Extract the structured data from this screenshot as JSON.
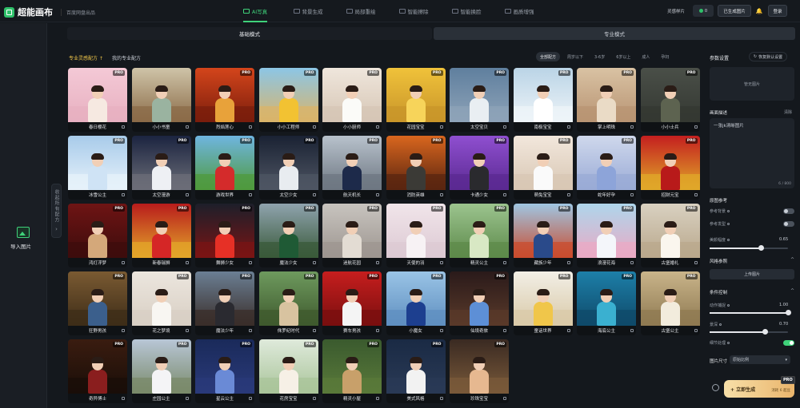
{
  "app": {
    "name": "超能画布",
    "sub": "百度网盘出品"
  },
  "nav": [
    {
      "label": "AI写真",
      "active": true
    },
    {
      "label": "背景生成",
      "active": false
    },
    {
      "label": "局部重绘",
      "active": false
    },
    {
      "label": "智能擦除",
      "active": false
    },
    {
      "label": "智能换脸",
      "active": false
    },
    {
      "label": "画质增强",
      "active": false
    }
  ],
  "topright": {
    "help": "灵感样片",
    "credits": "0",
    "generated": "已生成图片",
    "login": "登录"
  },
  "left": {
    "import_label": "导入图片",
    "collapse_label": "收起所有配方",
    "collapse_icon": "›"
  },
  "mode": {
    "basic": "基础模式",
    "pro": "专业模式"
  },
  "subtabs": [
    {
      "label": "专业灵感配方",
      "badge": "↑",
      "active": true
    },
    {
      "label": "我的专业配方",
      "active": false
    }
  ],
  "filters": [
    {
      "label": "全部配方",
      "active": true
    },
    {
      "label": "周岁以下",
      "active": false
    },
    {
      "label": "3-6岁",
      "active": false
    },
    {
      "label": "6岁以上",
      "active": false
    },
    {
      "label": "成人",
      "active": false
    },
    {
      "label": "孕妇",
      "active": false
    }
  ],
  "templates": [
    {
      "label": "春日樱花",
      "pro": true,
      "sky": "#f4c9d6",
      "ground": "#e7b0c0",
      "body": "#f6e9e1"
    },
    {
      "label": "小小书童",
      "pro": false,
      "sky": "#cfc4a8",
      "ground": "#8b6b48",
      "body": "#9ab3a0"
    },
    {
      "label": "烈焰莲心",
      "pro": true,
      "sky": "#d4451b",
      "ground": "#7a1d0c",
      "body": "#e8a23a"
    },
    {
      "label": "小小工程师",
      "pro": true,
      "sky": "#8cc6e6",
      "ground": "#d9b46a",
      "body": "#f2c232"
    },
    {
      "label": "小小厨师",
      "pro": true,
      "sky": "#efe6dc",
      "ground": "#d6c6b5",
      "body": "#fbfbf8"
    },
    {
      "label": "花园宝宝",
      "pro": true,
      "sky": "#f0c23a",
      "ground": "#c8952a",
      "body": "#f7d45a"
    },
    {
      "label": "太空宝贝",
      "pro": true,
      "sky": "#5f7f9e",
      "ground": "#8ea3b8",
      "body": "#e9eef2"
    },
    {
      "label": "南极宝宝",
      "pro": true,
      "sky": "#bad4e6",
      "ground": "#eef4f8",
      "body": "#ffffff"
    },
    {
      "label": "掌上明珠",
      "pro": true,
      "sky": "#d9c2a3",
      "ground": "#b89473",
      "body": "#eadbc6"
    },
    {
      "label": "小小士兵",
      "pro": true,
      "sky": "#4a4f48",
      "ground": "#343832",
      "body": "#5d6350"
    },
    {
      "label": "冰雪公主",
      "pro": true,
      "sky": "#a8cbea",
      "ground": "#e6f1fa",
      "body": "#cfe3f5"
    },
    {
      "label": "太空漫游",
      "pro": true,
      "sky": "#1b2440",
      "ground": "#6c6e78",
      "body": "#eef0f4"
    },
    {
      "label": "游戏世界",
      "pro": true,
      "sky": "#6fb5e0",
      "ground": "#4f9a3e",
      "body": "#d42b2b"
    },
    {
      "label": "太空少女",
      "pro": true,
      "sky": "#1a2233",
      "ground": "#4e5563",
      "body": "#e8ecf0"
    },
    {
      "label": "航天机长",
      "pro": true,
      "sky": "#b8c2cc",
      "ground": "#6e7782",
      "body": "#1d2a4a"
    },
    {
      "label": "消防英雄",
      "pro": true,
      "sky": "#d9661e",
      "ground": "#5a2510",
      "body": "#3b3a36"
    },
    {
      "label": "卡通少女",
      "pro": true,
      "sky": "#8f4fd0",
      "ground": "#5b2a92",
      "body": "#2a2a2e"
    },
    {
      "label": "萌兔宝宝",
      "pro": true,
      "sky": "#f2e7dc",
      "ground": "#d8c7b4",
      "body": "#fafafa"
    },
    {
      "label": "蛇年好孕",
      "pro": true,
      "sky": "#cfd8ec",
      "ground": "#9aabd6",
      "body": "#8da4d9"
    },
    {
      "label": "招财元宝",
      "pro": true,
      "sky": "#c41f1f",
      "ground": "#e0a829",
      "body": "#b81a1a"
    },
    {
      "label": "鸿灯浮梦",
      "pro": true,
      "sky": "#6e1414",
      "ground": "#3d0c0c",
      "body": "#d4a87a"
    },
    {
      "label": "新春瑞狮",
      "pro": true,
      "sky": "#b81c1c",
      "ground": "#e3a52a",
      "body": "#d52626"
    },
    {
      "label": "舞狮少女",
      "pro": true,
      "sky": "#1d1f2a",
      "ground": "#7a1414",
      "body": "#e63026"
    },
    {
      "label": "魔法少女",
      "pro": true,
      "sky": "#8fa3ae",
      "ground": "#3a5a3a",
      "body": "#1f5a35"
    },
    {
      "label": "迷航花园",
      "pro": true,
      "sky": "#c8c4bf",
      "ground": "#9d9690",
      "body": "#e3dcd3"
    },
    {
      "label": "天使的羽",
      "pro": true,
      "sky": "#f1e5ea",
      "ground": "#dcc9d3",
      "body": "#f7f2f4"
    },
    {
      "label": "精灵公主",
      "pro": true,
      "sky": "#9cc48f",
      "ground": "#5d8a4a",
      "body": "#d8e8c4"
    },
    {
      "label": "藏族少年",
      "pro": true,
      "sky": "#9fc6e3",
      "ground": "#c94c2e",
      "body": "#2a4a8a"
    },
    {
      "label": "浪漫花海",
      "pro": true,
      "sky": "#aed6ec",
      "ground": "#e9aac4",
      "body": "#f4f6fa"
    },
    {
      "label": "古堡婚礼",
      "pro": true,
      "sky": "#d9d1c1",
      "ground": "#b9a88c",
      "body": "#faf6ee"
    },
    {
      "label": "狂野男孩",
      "pro": true,
      "sky": "#7a5a32",
      "ground": "#3e2d18",
      "body": "#3b5f8c"
    },
    {
      "label": "花之梦境",
      "pro": true,
      "sky": "#ece6de",
      "ground": "#d8cfc4",
      "body": "#f8f6f2"
    },
    {
      "label": "魔法少年",
      "pro": true,
      "sky": "#6b7f94",
      "ground": "#3a2e2a",
      "body": "#2a2a30"
    },
    {
      "label": "侏罗纪时代",
      "pro": true,
      "sky": "#6e9a5e",
      "ground": "#3f5a2e",
      "body": "#d8c3a0"
    },
    {
      "label": "赛车男孩",
      "pro": true,
      "sky": "#c61e1e",
      "ground": "#7a0f0f",
      "body": "#f4f4f4"
    },
    {
      "label": "小魔女",
      "pro": true,
      "sky": "#9ac4e6",
      "ground": "#5f8fc0",
      "body": "#1d3f8f"
    },
    {
      "label": "仙境奇旅",
      "pro": true,
      "sky": "#2a1a1a",
      "ground": "#5a3a2a",
      "body": "#5d8fd6"
    },
    {
      "label": "童话世界",
      "pro": true,
      "sky": "#f2efe6",
      "ground": "#d9c9a8",
      "body": "#f0c64a"
    },
    {
      "label": "海底公主",
      "pro": true,
      "sky": "#1d7fa8",
      "ground": "#0f4a6a",
      "body": "#3ab0d0"
    },
    {
      "label": "古堡公主",
      "pro": true,
      "sky": "#c9b48a",
      "ground": "#8f7a52",
      "body": "#f2ecdd"
    },
    {
      "label": "奇异博士",
      "pro": true,
      "sky": "#3a1c10",
      "ground": "#1a0e08",
      "body": "#8a1e1e"
    },
    {
      "label": "庄园公主",
      "pro": true,
      "sky": "#b8c6d6",
      "ground": "#7a8a6a",
      "body": "#f4f4f6"
    },
    {
      "label": "星云公主",
      "pro": true,
      "sky": "#1a2a5a",
      "ground": "#2a3a7a",
      "body": "#6a8ad6"
    },
    {
      "label": "花房宝宝",
      "pro": true,
      "sky": "#dfeadb",
      "ground": "#a9c49a",
      "body": "#f6f0e6"
    },
    {
      "label": "精灵小屋",
      "pro": true,
      "sky": "#3a5a2e",
      "ground": "#5a7a3a",
      "body": "#c8a06a"
    },
    {
      "label": "美式风格",
      "pro": true,
      "sky": "#1a2a44",
      "ground": "#2a3a56",
      "body": "#f2f2f2"
    },
    {
      "label": "珍珠宝宝",
      "pro": true,
      "sky": "#3a2a22",
      "ground": "#7a5a3a",
      "body": "#e6b890"
    }
  ],
  "panel": {
    "title": "参数设置",
    "reset": "恢复默认设置",
    "reset_icon": "↻",
    "upload_box": "管无图片",
    "desc_title": "画面描述",
    "clear": "清除",
    "desc_text": "一张jk清晰图片",
    "desc_count": "6 / 800",
    "ref_title": "原图参考",
    "ref_bg": "参考背景",
    "ref_hair": "参考发型",
    "beauty_label": "美颜幅度",
    "beauty_value": "0.65",
    "beauty_fraction": 0.65,
    "style_ref": "风格参照",
    "style_upload": "上传图片",
    "condition": "条件控制",
    "pose_label": "动作捕捉",
    "pose_value": "1.00",
    "pose_fraction": 1.0,
    "depth_label": "景深",
    "depth_value": "0.70",
    "depth_fraction": 0.7,
    "detail_label": "细节处理",
    "size_label": "图片尺寸",
    "size_value": "原始比例",
    "size_chevron": "▾",
    "generate": "+ 立即生成",
    "generate_cost": "消耗 6 超豆",
    "pro_badge": "PRO",
    "section_chevron": "^",
    "toggles": {
      "ref_bg": false,
      "ref_hair": false,
      "detail": true
    }
  },
  "colors": {
    "accent": "#3fd27a",
    "brand": "#2fc16a",
    "highlight": "#f0c64a"
  }
}
